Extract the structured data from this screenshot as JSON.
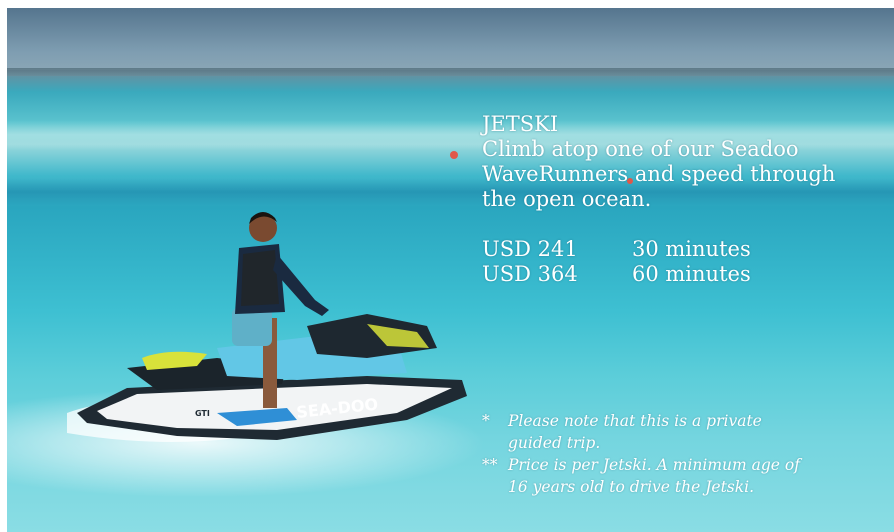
{
  "activity": {
    "title": "JETSKI",
    "description": "Climb atop one of our Seadoo WaveRunners and speed through the open ocean."
  },
  "prices": [
    {
      "amount": "USD 241",
      "duration": "30 minutes"
    },
    {
      "amount": "USD 364",
      "duration": "60 minutes"
    }
  ],
  "notes": [
    {
      "mark": "*",
      "text": "Please note that this is a private guided trip."
    },
    {
      "mark": "**",
      "text": "Price is per Jetski. A minimum age of 16 years old to drive the Jetski."
    }
  ],
  "photo": {
    "brand_text": "SEA-DOO",
    "model_text": "GTI"
  },
  "colors": {
    "water": "#33b3c9",
    "text": "#ffffff",
    "jetski_accent": "#d8e23a",
    "jetski_blue": "#2f8fd6"
  }
}
